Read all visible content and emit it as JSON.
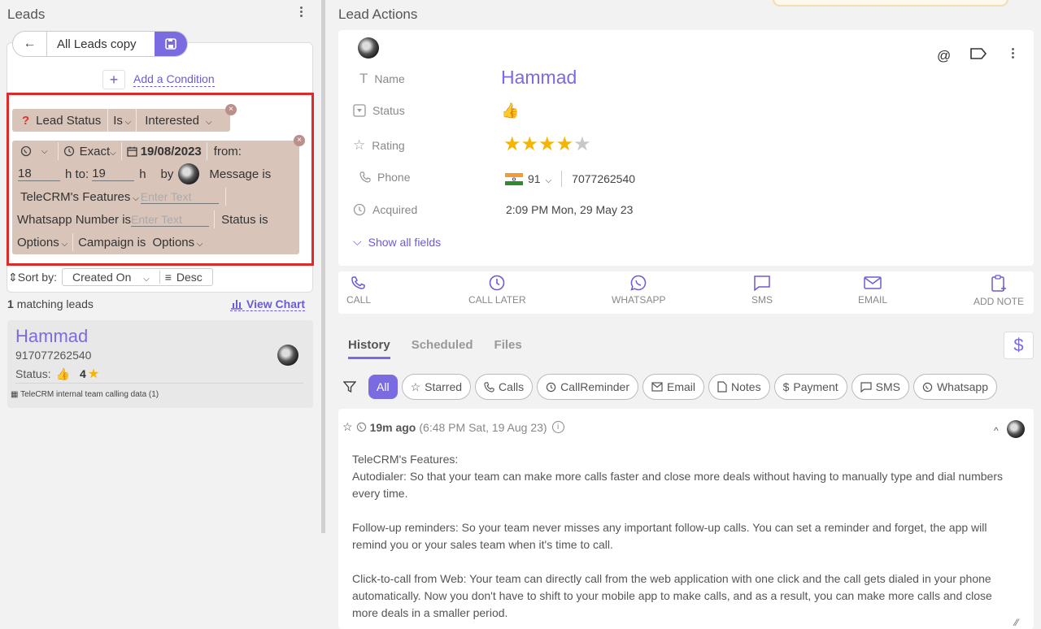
{
  "left_panel": {
    "title": "Leads",
    "view_name": "All Leads copy",
    "add_condition": "Add a Condition",
    "filter1": {
      "field": "Lead Status",
      "op": "Is",
      "value": "Interested"
    },
    "filter2": {
      "mode": "Exact",
      "date": "19/08/2023",
      "from_label": "from:",
      "from_value": "18",
      "to_label": "h to:",
      "to_value": "19",
      "h_label": "h",
      "by_label": "by",
      "message_label": "Message is",
      "message_value": "TeleCRM's Features",
      "enter_text": "Enter Text",
      "whatsapp_label": "Whatsapp Number is",
      "status_label": "Status is",
      "options": "Options",
      "campaign_label": "Campaign is"
    },
    "sort": {
      "label": "Sort by:",
      "field": "Created On",
      "order": "Desc"
    },
    "matching": "1 matching leads",
    "view_chart": "View Chart",
    "lead": {
      "name": "Hammad",
      "phone": "917077262540",
      "status_label": "Status:",
      "rating": "4",
      "tag": "TeleCRM internal team calling data (1)"
    }
  },
  "right_panel": {
    "title": "Lead Actions",
    "fields": {
      "name_label": "Name",
      "name_value": "Hammad",
      "status_label": "Status",
      "rating_label": "Rating",
      "rating": 4,
      "rating_max": 5,
      "phone_label": "Phone",
      "country_code": "91",
      "phone_value": "7077262540",
      "acquired_label": "Acquired",
      "acquired_value": "2:09 PM Mon, 29 May 23",
      "show_all": "Show all fields"
    },
    "actions": [
      "CALL",
      "CALL LATER",
      "WHATSAPP",
      "SMS",
      "EMAIL",
      "ADD NOTE"
    ],
    "tabs": [
      "History",
      "Scheduled",
      "Files"
    ],
    "filters": {
      "all": "All",
      "starred": "Starred",
      "calls": "Calls",
      "reminder": "CallReminder",
      "email": "Email",
      "notes": "Notes",
      "payment": "Payment",
      "sms": "SMS",
      "whatsapp": "Whatsapp"
    },
    "message": {
      "ago": "19m ago",
      "time": "(6:48 PM Sat, 19 Aug 23)",
      "line1": "TeleCRM's Features:",
      "line2": "Autodialer: So that your team can make more calls faster and close more deals without having to manually type and dial numbers every time.",
      "para2": "Follow-up reminders: So your team never misses any important follow-up calls. You can set a reminder and forget, the app will remind you or your sales team when it's time to call.",
      "para3": "Click-to-call from Web: Your team can directly call from the web application with one click and the call gets dialed in your phone automatically. Now you don't have to shift to your mobile app to make calls, and as a result, you can make more calls and close more deals in a smaller period."
    }
  },
  "colors": {
    "accent": "#7b6be0",
    "highlight": "#dd2b2b",
    "chip": "#d9c4b9",
    "star": "#f5b400"
  }
}
